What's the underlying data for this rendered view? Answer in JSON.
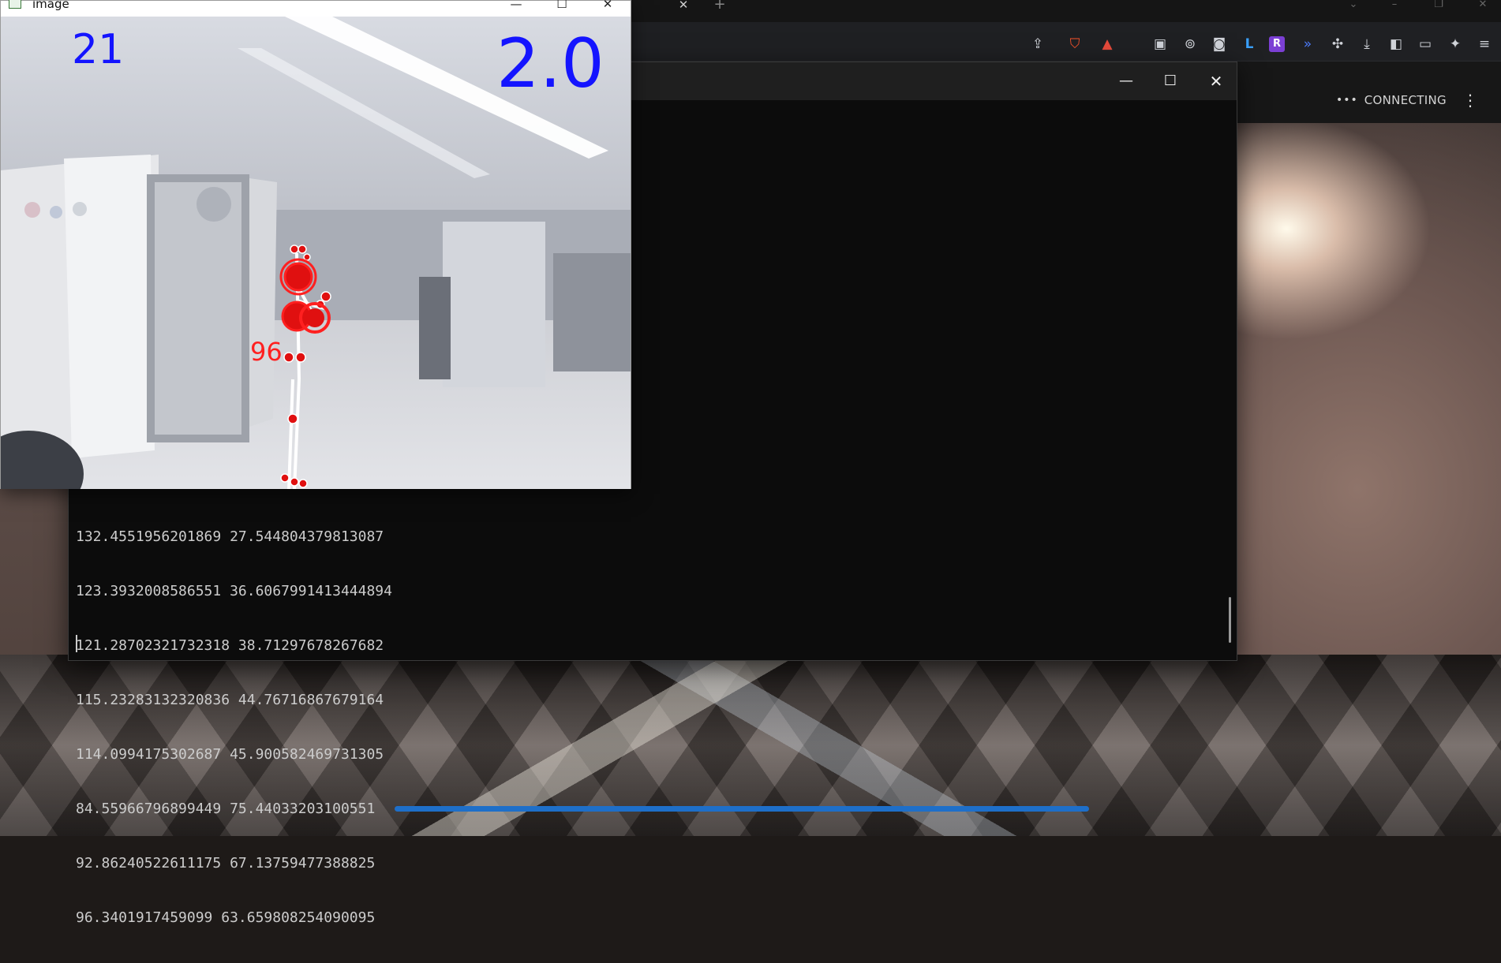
{
  "browser": {
    "tab_close_glyph": "✕",
    "new_tab_glyph": "+",
    "toolbar_icons": [
      "share-icon",
      "brave-shield-icon",
      "brave-rewards-icon",
      "extension-photo-icon",
      "extension-glasses-icon",
      "extension-camera-icon",
      "extension-l-icon",
      "extension-r-icon",
      "extension-wave-icon",
      "extensions-puzzle-icon",
      "downloads-icon",
      "sidebar-icon",
      "wallet-icon",
      "leo-ai-icon",
      "menu-icon"
    ]
  },
  "app": {
    "status": "CONNECTING",
    "status_dots": "•••",
    "menu_glyph": "⋮"
  },
  "image_window": {
    "title": "image",
    "overlay": {
      "frame_count": "21",
      "scale": "2.0",
      "angle": "96"
    }
  },
  "terminal": {
    "lines": [
      "132.4551956201869 27.544804379813087",
      "123.3932008586551 36.6067991413444894",
      "121.28702321732318 38.71297678267682",
      "115.23283132320836 44.76716867679164",
      "114.0994175302687 45.900582469731305",
      "84.55966796899449 75.44033203100551",
      "92.86240522611175 67.13759477388825",
      "96.3401917459099 63.659808254090095"
    ]
  },
  "colors": {
    "overlay_text_blue": "#1414ff",
    "pose_red": "#ff2020",
    "progress_blue": "#1e6fc9"
  }
}
